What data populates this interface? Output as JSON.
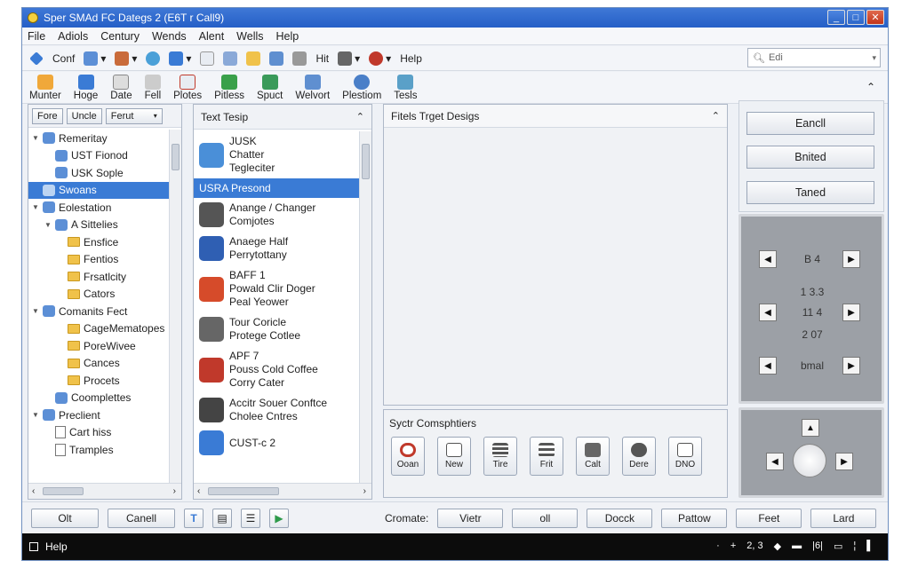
{
  "window": {
    "title": "Sper SMAd FC Dategs 2 (E6T r Call9)"
  },
  "menu": [
    "File",
    "Adiols",
    "Century",
    "Wends",
    "Alent",
    "Wells",
    "Help"
  ],
  "toolbar1": {
    "conf": "Conf",
    "hit": "Hit",
    "help": "Help",
    "search_placeholder": "Edi"
  },
  "toolbar2": [
    "Munter",
    "Hoge",
    "Date",
    "Fell",
    "Plotes",
    "Pitless",
    "Spuct",
    "Welvort",
    "Plestiom",
    "Tesls"
  ],
  "left_panel": {
    "buttons": [
      "Fore",
      "Uncle",
      "Ferut"
    ],
    "tree": [
      {
        "label": "Remeritay",
        "level": 0,
        "kind": "expand"
      },
      {
        "label": "UST Fionod",
        "level": 1,
        "kind": "item"
      },
      {
        "label": "USK Sople",
        "level": 1,
        "kind": "item"
      },
      {
        "label": "Swoans",
        "level": 0,
        "kind": "selected"
      },
      {
        "label": "Eolestation",
        "level": 0,
        "kind": "expand"
      },
      {
        "label": "A  Sittelies",
        "level": 1,
        "kind": "expand"
      },
      {
        "label": "Ensfice",
        "level": 2,
        "kind": "folder"
      },
      {
        "label": "Fentios",
        "level": 2,
        "kind": "folder"
      },
      {
        "label": "Frsatlcity",
        "level": 2,
        "kind": "folder"
      },
      {
        "label": "Cators",
        "level": 2,
        "kind": "folder"
      },
      {
        "label": "Comanits Fect",
        "level": 0,
        "kind": "expand"
      },
      {
        "label": "CageMematopes",
        "level": 2,
        "kind": "folder"
      },
      {
        "label": "PoreWivee",
        "level": 2,
        "kind": "folder"
      },
      {
        "label": "Cances",
        "level": 2,
        "kind": "folder"
      },
      {
        "label": "Procets",
        "level": 2,
        "kind": "folder"
      },
      {
        "label": "Coomplettes",
        "level": 1,
        "kind": "item"
      },
      {
        "label": "Preclient",
        "level": 0,
        "kind": "expand"
      },
      {
        "label": "Cart hiss",
        "level": 1,
        "kind": "doc"
      },
      {
        "label": "Tramples",
        "level": 1,
        "kind": "doc"
      }
    ]
  },
  "mid_panel": {
    "title": "Text Tesip",
    "items": [
      {
        "lines": [
          "JUSK",
          "Chatter",
          "Tegleciter"
        ],
        "color": "#4a8fd8"
      },
      {
        "lines": [
          "USRA Presond"
        ],
        "selected": true
      },
      {
        "lines": [
          "Anange / Changer",
          "Comjotes"
        ],
        "color": "#555555"
      },
      {
        "lines": [
          "Anaege Half",
          "Perrytottany"
        ],
        "color": "#2f5fb3"
      },
      {
        "lines": [
          "BAFF 1",
          "Powald Clir Doger",
          "Peal Yeower"
        ],
        "color": "#d64b2a"
      },
      {
        "lines": [
          "Tour Coricle",
          "Protege Cotlee"
        ],
        "color": "#666666"
      },
      {
        "lines": [
          "APF 7",
          "Pouss Cold Coffee",
          "Corry Cater"
        ],
        "color": "#c0392b"
      },
      {
        "lines": [
          "Accitr Souer Conftce",
          "Cholee Cntres"
        ],
        "color": "#444444"
      },
      {
        "lines": [
          "CUST-c 2"
        ],
        "color": "#3a7bd5"
      }
    ]
  },
  "center": {
    "title": "Fitels Trget Desigs",
    "cmd_title": "Syctr Comsphtiers",
    "cmds": [
      "Ooan",
      "New",
      "Tire",
      "Frit",
      "Calt",
      "Dere",
      "DNO"
    ]
  },
  "right": {
    "buttons": [
      "Eancll",
      "Bnited",
      "Taned"
    ],
    "grid_text": [
      "B   4",
      "1   3.3",
      "11      4",
      "2   07",
      "bmal"
    ]
  },
  "bottom": {
    "left_buttons": [
      "Olt",
      "Canell"
    ],
    "label": "Cromate:",
    "right_buttons": [
      "Vietr",
      "oll",
      "Docck",
      "Pattow",
      "Feet",
      "Lard"
    ]
  },
  "status": {
    "text": "Help",
    "right": "2, 3"
  }
}
